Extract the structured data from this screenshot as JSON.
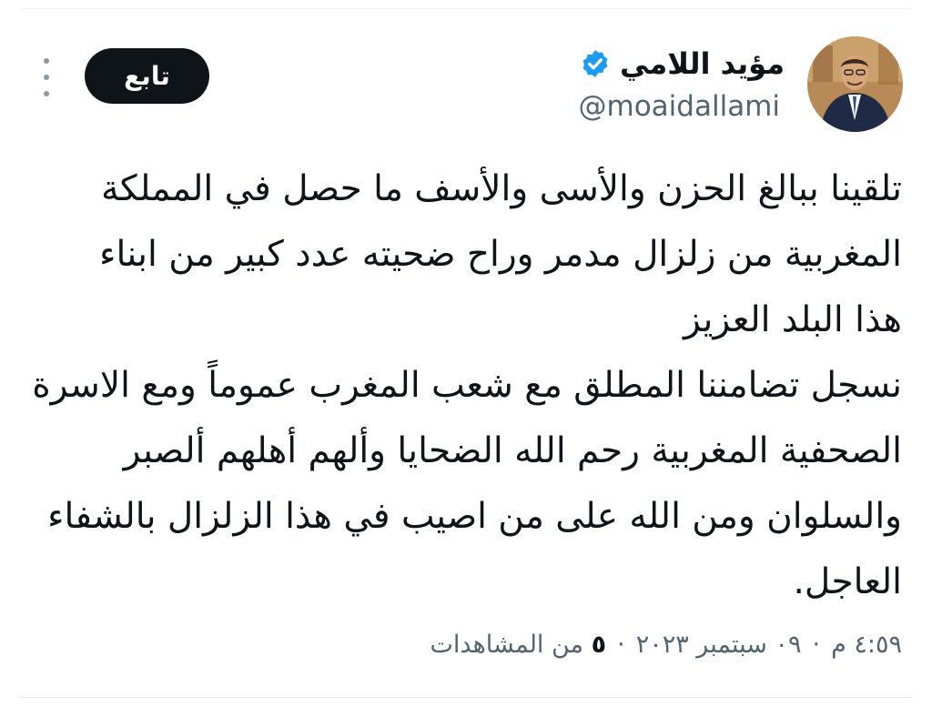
{
  "author": {
    "display_name": "مؤيد اللامي",
    "handle": "@moaidallami",
    "verified_icon": "verified-badge-icon",
    "verified_color": "#1d9bf0"
  },
  "header": {
    "follow_label": "تابع",
    "more_icon": "more-options-icon"
  },
  "tweet": {
    "lines": [
      "تلقينا ببالغ الحزن والأسى والأسف ما حصل في المملكة",
      "المغربية من زلزال مدمر وراح ضحيته عدد كبير من ابناء",
      "هذا البلد العزيز",
      "نسجل تضامننا المطلق مع شعب المغرب عموماً ومع الاسرة",
      "الصحفية المغربية رحم الله الضحايا وألهم أهلهم ألصبر",
      "والسلوان  ومن الله على من اصيب في هذا الزلزال بالشفاء",
      "العاجل."
    ]
  },
  "meta": {
    "time": "٤:٥٩ م",
    "separator": "·",
    "date": "٠٩ سبتمبر ٢٠٢٣",
    "views_count": "٥",
    "views_label": "من المشاهدات"
  },
  "colors": {
    "text_primary": "#0f1419",
    "text_secondary": "#536471",
    "button_background": "#0f1419",
    "accent": "#1d9bf0"
  }
}
